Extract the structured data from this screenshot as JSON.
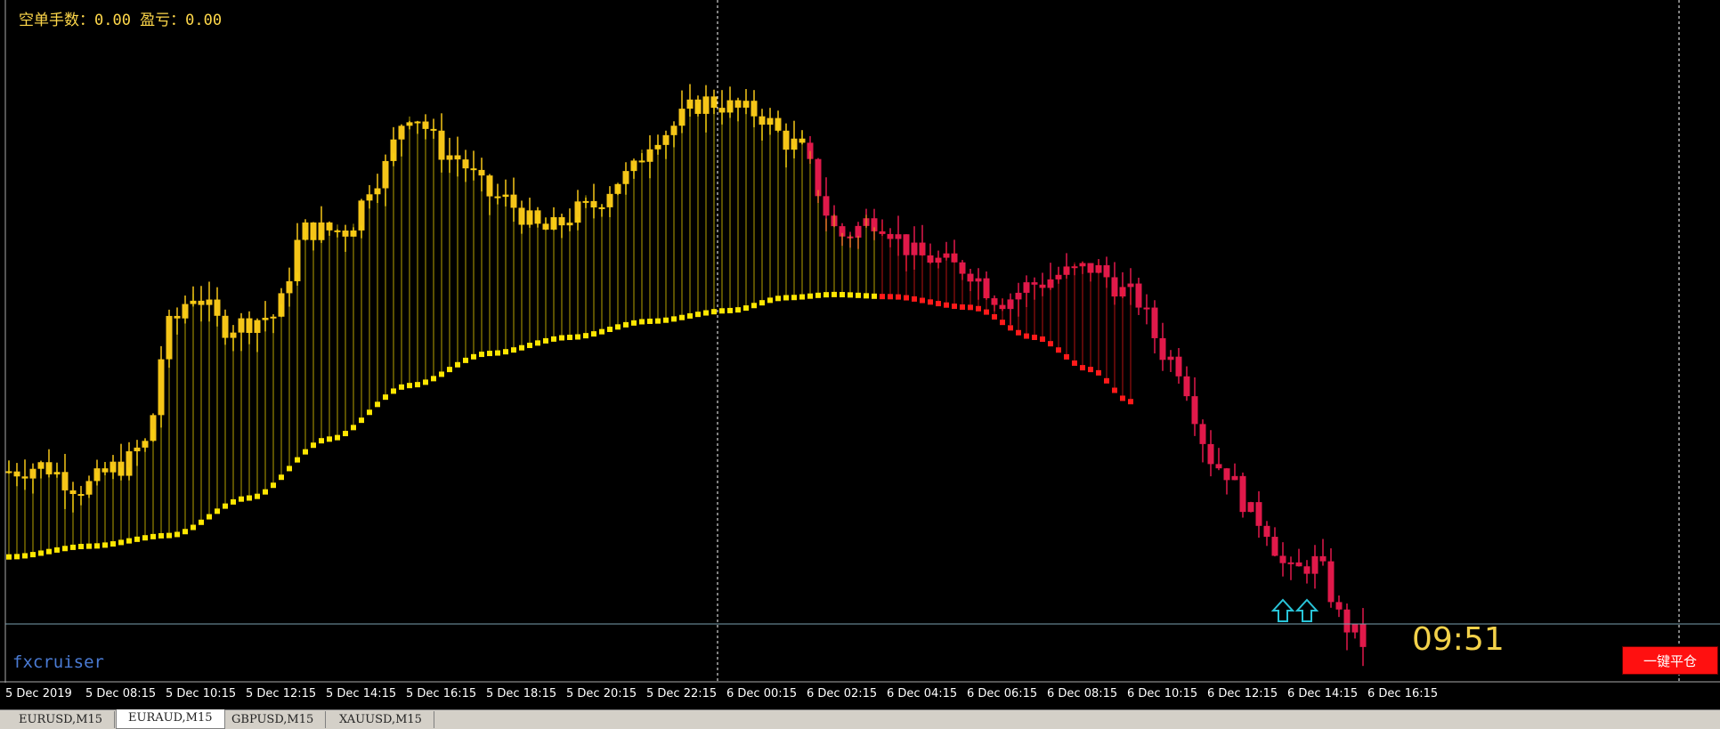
{
  "info": {
    "short_stats": "空单手数：0.00 盈亏：0.00"
  },
  "watermark": "fxcruiser",
  "countdown": "09:51",
  "close_all_button": "一键平仓",
  "time_axis": [
    "5 Dec 2019",
    "5 Dec 08:15",
    "5 Dec 10:15",
    "5 Dec 12:15",
    "5 Dec 14:15",
    "5 Dec 16:15",
    "5 Dec 18:15",
    "5 Dec 20:15",
    "5 Dec 22:15",
    "6 Dec 00:15",
    "6 Dec 02:15",
    "6 Dec 04:15",
    "6 Dec 06:15",
    "6 Dec 08:15",
    "6 Dec 10:15",
    "6 Dec 12:15",
    "6 Dec 14:15",
    "6 Dec 16:15"
  ],
  "tabs": [
    {
      "label": "EURUSD,M15",
      "active": false
    },
    {
      "label": "EURAUD,M15",
      "active": true
    },
    {
      "label": "GBPUSD,M15",
      "active": false
    },
    {
      "label": "XAUUSD,M15",
      "active": false
    }
  ],
  "colors": {
    "bull": "#f5c518",
    "bear": "#e0194a",
    "ma_up": "#ffe600",
    "ma_down": "#ff1a1a",
    "signal_arrow": "#29c4d8",
    "grid": "#ffffff",
    "price_line": "#7aa0b0"
  },
  "icons": {
    "buy_signal": "up-arrow-icon"
  },
  "chart_data": {
    "type": "candlestick",
    "bars_shown": 170,
    "anchors_close": [
      [
        0,
        0.6785
      ],
      [
        4,
        0.679
      ],
      [
        9,
        0.677
      ],
      [
        14,
        0.679
      ],
      [
        17,
        0.681
      ],
      [
        20,
        0.692
      ],
      [
        23,
        0.695
      ],
      [
        27,
        0.692
      ],
      [
        33,
        0.693
      ],
      [
        37,
        0.701
      ],
      [
        42,
        0.701
      ],
      [
        46,
        0.706
      ],
      [
        50,
        0.712
      ],
      [
        55,
        0.708
      ],
      [
        61,
        0.704
      ],
      [
        67,
        0.701
      ],
      [
        72,
        0.703
      ],
      [
        77,
        0.706
      ],
      [
        81,
        0.71
      ],
      [
        87,
        0.713
      ],
      [
        93,
        0.712
      ],
      [
        98,
        0.709
      ],
      [
        104,
        0.7005
      ],
      [
        108,
        0.702
      ],
      [
        114,
        0.6985
      ],
      [
        119,
        0.6975
      ],
      [
        124,
        0.6945
      ],
      [
        128,
        0.696
      ],
      [
        132,
        0.697
      ],
      [
        135,
        0.6975
      ],
      [
        140,
        0.695
      ],
      [
        145,
        0.689
      ],
      [
        151,
        0.679
      ],
      [
        156,
        0.674
      ],
      [
        160,
        0.669
      ],
      [
        163,
        0.67
      ],
      [
        167,
        0.664
      ],
      [
        169,
        0.6625
      ]
    ],
    "ma_anchors": [
      [
        0,
        0.6705
      ],
      [
        10,
        0.6715
      ],
      [
        20,
        0.6725
      ],
      [
        30,
        0.676
      ],
      [
        40,
        0.6815
      ],
      [
        50,
        0.6865
      ],
      [
        60,
        0.6895
      ],
      [
        70,
        0.691
      ],
      [
        80,
        0.6925
      ],
      [
        90,
        0.6935
      ],
      [
        97,
        0.6947
      ],
      [
        103,
        0.695
      ],
      [
        110,
        0.6948
      ],
      [
        120,
        0.6938
      ],
      [
        128,
        0.691
      ],
      [
        135,
        0.688
      ],
      [
        140,
        0.685
      ]
    ],
    "buy_signals_at_bar": [
      159,
      162
    ],
    "ylim": [
      0.661,
      0.722
    ]
  }
}
